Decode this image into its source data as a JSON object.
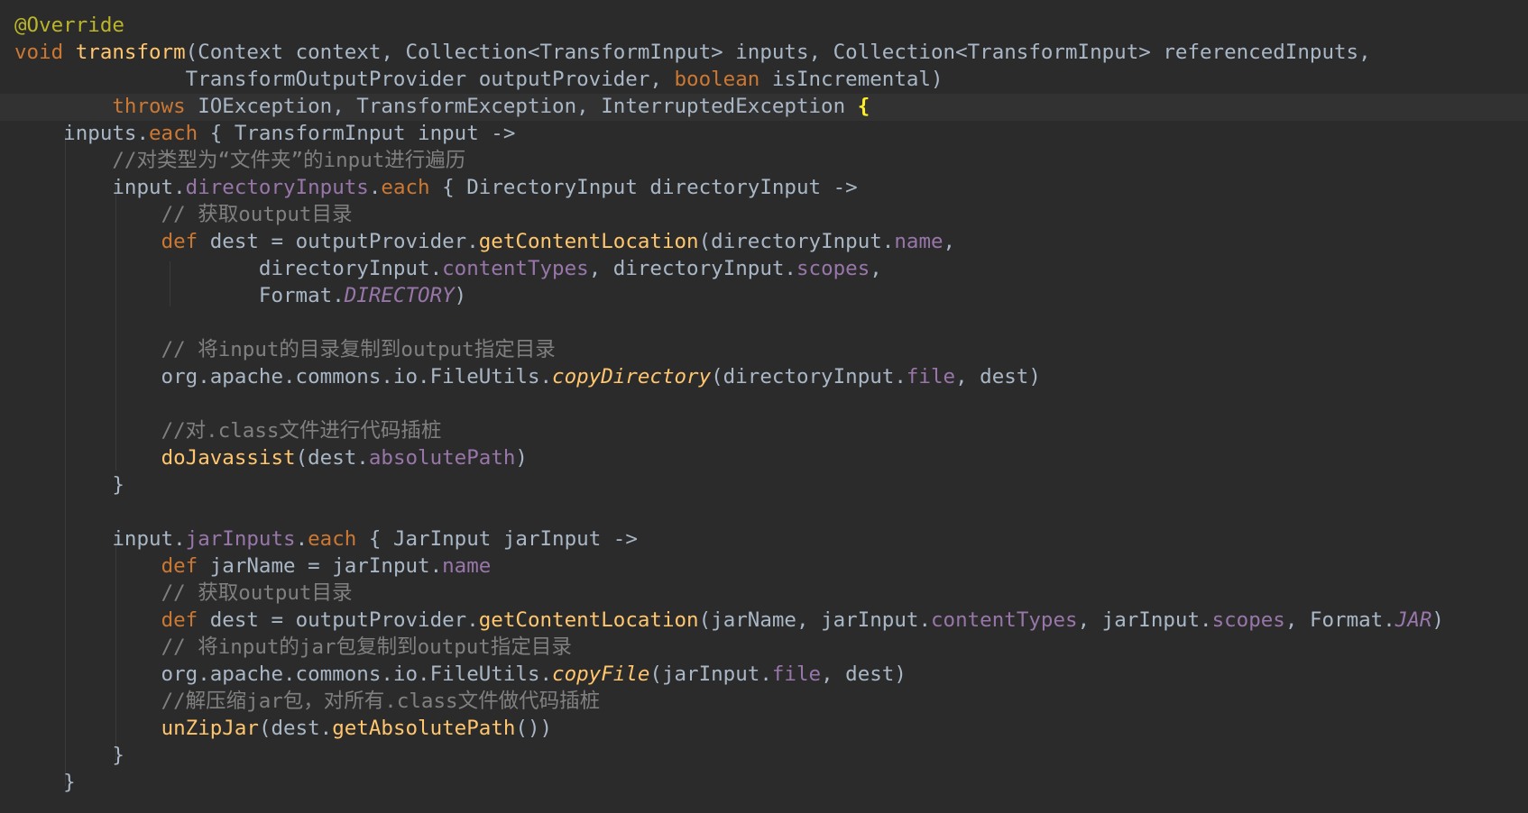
{
  "colors": {
    "background": "#2b2b2b",
    "current_line": "#323232",
    "default_text": "#a9b7c6",
    "keyword": "#cc7832",
    "method": "#ffc66d",
    "property": "#9876aa",
    "comment": "#808080",
    "annotation": "#bbb529",
    "matched_brace": "#ffef28"
  },
  "lines": [
    {
      "tokens": [
        {
          "t": "@Override",
          "c": "ann"
        }
      ]
    },
    {
      "tokens": [
        {
          "t": "void",
          "c": "kw"
        },
        {
          "t": " "
        },
        {
          "t": "transform",
          "c": "fn"
        },
        {
          "t": "(Context context, Collection<TransformInput> inputs, Collection<TransformInput> referencedInputs,"
        }
      ]
    },
    {
      "tokens": [
        {
          "t": "              TransformOutputProvider outputProvider, "
        },
        {
          "t": "boolean",
          "c": "kw"
        },
        {
          "t": " isIncremental)"
        }
      ]
    },
    {
      "tokens": [
        {
          "t": "        "
        },
        {
          "t": "throws",
          "c": "kw"
        },
        {
          "t": " IOException, TransformException, InterruptedException "
        },
        {
          "t": "{",
          "c": "brace-hl"
        }
      ]
    },
    {
      "tokens": [
        {
          "t": "    inputs."
        },
        {
          "t": "each",
          "c": "kw"
        },
        {
          "t": " { TransformInput input ->"
        }
      ]
    },
    {
      "tokens": [
        {
          "t": "        "
        },
        {
          "t": "//对类型为“文件夹”的input进行遍历",
          "c": "cm"
        }
      ]
    },
    {
      "tokens": [
        {
          "t": "        input."
        },
        {
          "t": "directoryInputs",
          "c": "pr"
        },
        {
          "t": "."
        },
        {
          "t": "each",
          "c": "kw"
        },
        {
          "t": " { DirectoryInput directoryInput ->"
        }
      ]
    },
    {
      "tokens": [
        {
          "t": "            "
        },
        {
          "t": "// 获取output目录",
          "c": "cm"
        }
      ]
    },
    {
      "tokens": [
        {
          "t": "            "
        },
        {
          "t": "def",
          "c": "kw"
        },
        {
          "t": " dest = outputProvider."
        },
        {
          "t": "getContentLocation",
          "c": "fn"
        },
        {
          "t": "(directoryInput."
        },
        {
          "t": "name",
          "c": "pr"
        },
        {
          "t": ","
        }
      ]
    },
    {
      "tokens": [
        {
          "t": "                    directoryInput."
        },
        {
          "t": "contentTypes",
          "c": "pr"
        },
        {
          "t": ", directoryInput."
        },
        {
          "t": "scopes",
          "c": "pr"
        },
        {
          "t": ","
        }
      ]
    },
    {
      "tokens": [
        {
          "t": "                    Format."
        },
        {
          "t": "DIRECTORY",
          "c": "pi"
        },
        {
          "t": ")"
        }
      ]
    },
    {
      "tokens": []
    },
    {
      "tokens": [
        {
          "t": "            "
        },
        {
          "t": "// 将input的目录复制到output指定目录",
          "c": "cm"
        }
      ]
    },
    {
      "tokens": [
        {
          "t": "            org.apache.commons.io.FileUtils."
        },
        {
          "t": "copyDirectory",
          "c": "fi"
        },
        {
          "t": "(directoryInput."
        },
        {
          "t": "file",
          "c": "pr"
        },
        {
          "t": ", dest)"
        }
      ]
    },
    {
      "tokens": []
    },
    {
      "tokens": [
        {
          "t": "            "
        },
        {
          "t": "//对.class文件进行代码插桩",
          "c": "cm"
        }
      ]
    },
    {
      "tokens": [
        {
          "t": "            "
        },
        {
          "t": "doJavassist",
          "c": "fn"
        },
        {
          "t": "(dest."
        },
        {
          "t": "absolutePath",
          "c": "pr"
        },
        {
          "t": ")"
        }
      ]
    },
    {
      "tokens": [
        {
          "t": "        }"
        }
      ]
    },
    {
      "tokens": []
    },
    {
      "tokens": [
        {
          "t": "        input."
        },
        {
          "t": "jarInputs",
          "c": "pr"
        },
        {
          "t": "."
        },
        {
          "t": "each",
          "c": "kw"
        },
        {
          "t": " { JarInput jarInput ->"
        }
      ]
    },
    {
      "tokens": [
        {
          "t": "            "
        },
        {
          "t": "def",
          "c": "kw"
        },
        {
          "t": " jarName = jarInput."
        },
        {
          "t": "name",
          "c": "pr"
        }
      ]
    },
    {
      "tokens": [
        {
          "t": "            "
        },
        {
          "t": "// 获取output目录",
          "c": "cm"
        }
      ]
    },
    {
      "tokens": [
        {
          "t": "            "
        },
        {
          "t": "def",
          "c": "kw"
        },
        {
          "t": " dest = outputProvider."
        },
        {
          "t": "getContentLocation",
          "c": "fn"
        },
        {
          "t": "(jarName, jarInput."
        },
        {
          "t": "contentTypes",
          "c": "pr"
        },
        {
          "t": ", jarInput."
        },
        {
          "t": "scopes",
          "c": "pr"
        },
        {
          "t": ", Format."
        },
        {
          "t": "JAR",
          "c": "pi"
        },
        {
          "t": ")"
        }
      ]
    },
    {
      "tokens": [
        {
          "t": "            "
        },
        {
          "t": "// 将input的jar包复制到output指定目录",
          "c": "cm"
        }
      ]
    },
    {
      "tokens": [
        {
          "t": "            org.apache.commons.io.FileUtils."
        },
        {
          "t": "copyFile",
          "c": "fi"
        },
        {
          "t": "(jarInput."
        },
        {
          "t": "file",
          "c": "pr"
        },
        {
          "t": ", dest)"
        }
      ]
    },
    {
      "tokens": [
        {
          "t": "            "
        },
        {
          "t": "//解压缩jar包，对所有.class文件做代码插桩",
          "c": "cm"
        }
      ]
    },
    {
      "tokens": [
        {
          "t": "            "
        },
        {
          "t": "unZipJar",
          "c": "fn"
        },
        {
          "t": "(dest."
        },
        {
          "t": "getAbsolutePath",
          "c": "fn"
        },
        {
          "t": "())"
        }
      ]
    },
    {
      "tokens": [
        {
          "t": "        }"
        }
      ]
    },
    {
      "tokens": [
        {
          "t": "    }"
        }
      ]
    }
  ]
}
